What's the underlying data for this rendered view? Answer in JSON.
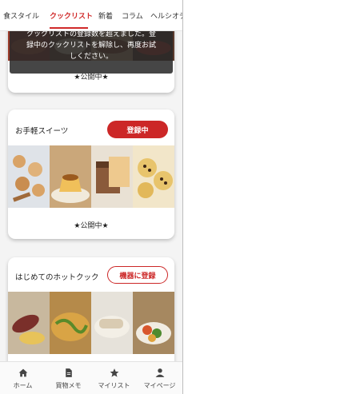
{
  "tabs": [
    "食スタイル",
    "クックリスト",
    "新着",
    "コラム",
    "ヘルシオデ"
  ],
  "toast": {
    "line1": "クックリストの登録数を超えました。登",
    "line2": "録中のクックリストを解除し、再度お試",
    "line3": "しください。"
  },
  "cards": [
    {
      "status": "★公開中★"
    },
    {
      "title": "お手軽スイーツ",
      "button": "登録中",
      "status": "★公開中★"
    },
    {
      "title": "はじめてのホットクック",
      "button": "機器に登録"
    }
  ],
  "bottom_nav": [
    {
      "label": "ホーム",
      "icon": "home-icon"
    },
    {
      "label": "買物メモ",
      "icon": "memo-icon"
    },
    {
      "label": "マイリスト",
      "icon": "star-icon"
    },
    {
      "label": "マイページ",
      "icon": "person-icon"
    }
  ],
  "colors": {
    "accent": "#cc2727",
    "toast": "#282828"
  }
}
